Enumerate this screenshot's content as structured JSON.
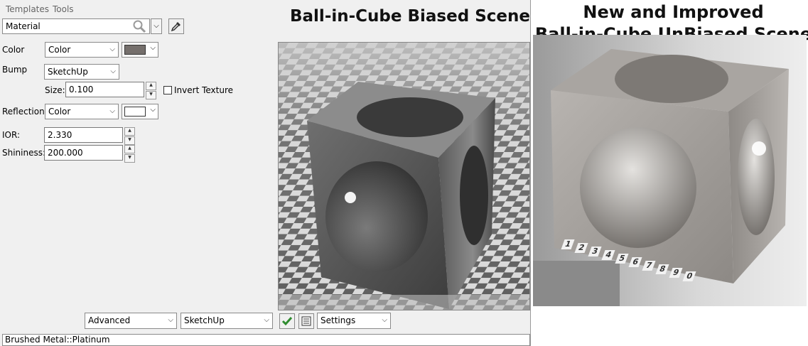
{
  "menu": {
    "templates": "Templates",
    "tools": "Tools"
  },
  "material_select": {
    "value": "Material"
  },
  "color": {
    "label": "Color",
    "mode": "Color",
    "swatch": "#756f6c"
  },
  "bump": {
    "label": "Bump",
    "mode": "SketchUp",
    "size_label": "Size:",
    "size_value": "0.100",
    "invert_label": "Invert Texture"
  },
  "reflection": {
    "label": "Reflection",
    "mode": "Color",
    "swatch": "#ffffff"
  },
  "ior": {
    "label": "IOR:",
    "value": "2.330"
  },
  "shininess": {
    "label": "Shininess:",
    "value": "200.000"
  },
  "bottom": {
    "advanced": "Advanced",
    "sketchup": "SketchUp",
    "settings": "Settings"
  },
  "status": "Brushed Metal::Platinum",
  "titles": {
    "biased": "Ball-in-Cube Biased Scene",
    "unbiased_line1": "New and Improved",
    "unbiased_line2": "Ball-in-Cube UnBiased Scene"
  },
  "floor_numbers": [
    "1",
    "2",
    "3",
    "4",
    "5",
    "6",
    "7",
    "8",
    "9",
    "0"
  ]
}
